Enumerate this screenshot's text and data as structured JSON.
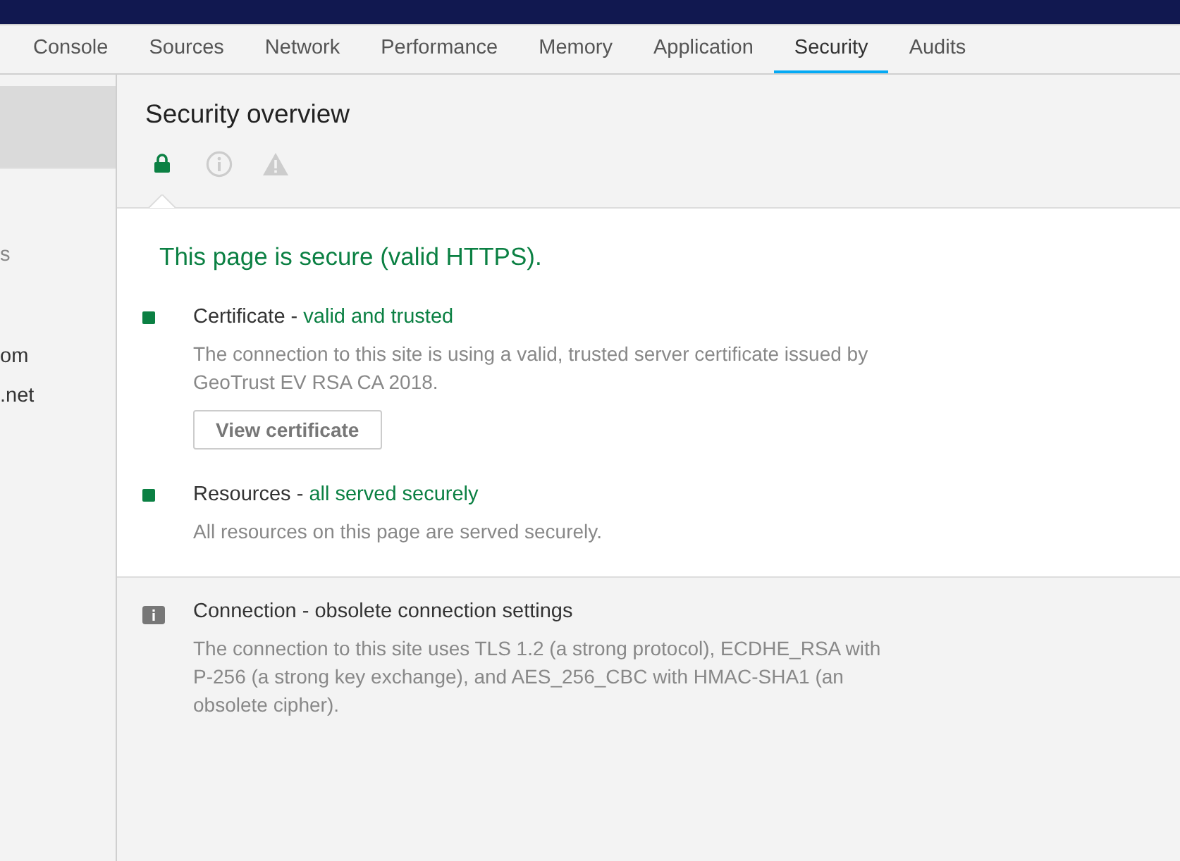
{
  "tabs": [
    {
      "label": "Console",
      "selected": false
    },
    {
      "label": "Sources",
      "selected": false
    },
    {
      "label": "Network",
      "selected": false
    },
    {
      "label": "Performance",
      "selected": false
    },
    {
      "label": "Memory",
      "selected": false
    },
    {
      "label": "Application",
      "selected": false
    },
    {
      "label": "Security",
      "selected": true
    },
    {
      "label": "Audits",
      "selected": false
    }
  ],
  "sidebar": {
    "items": [
      {
        "kind": "overview",
        "selected": true
      },
      {
        "kind": "heading",
        "label": "s",
        "selected": false
      },
      {
        "kind": "origin",
        "label": "om",
        "selected": false
      },
      {
        "kind": "origin",
        "label": ".net",
        "selected": false
      }
    ]
  },
  "overview": {
    "title": "Security overview",
    "filters": [
      {
        "kind": "secure",
        "selected": true
      },
      {
        "kind": "info",
        "selected": false
      },
      {
        "kind": "warning",
        "selected": false
      }
    ],
    "summary": "This page is secure (valid HTTPS).",
    "sections": [
      {
        "kind": "secure",
        "title": "Certificate -",
        "status": "valid and trusted",
        "description": "The connection to this site is using a valid, trusted server certificate issued by GeoTrust EV RSA CA 2018.",
        "button": "View certificate"
      },
      {
        "kind": "secure",
        "title": "Resources -",
        "status": "all served securely",
        "description": "All resources on this page are served securely."
      },
      {
        "kind": "info",
        "title": "Connection - obsolete connection settings",
        "description": "The connection to this site uses TLS 1.2 (a strong protocol), ECDHE_RSA with P-256 (a strong key exchange), and AES_256_CBC with HMAC-SHA1 (an obsolete cipher)."
      }
    ]
  }
}
